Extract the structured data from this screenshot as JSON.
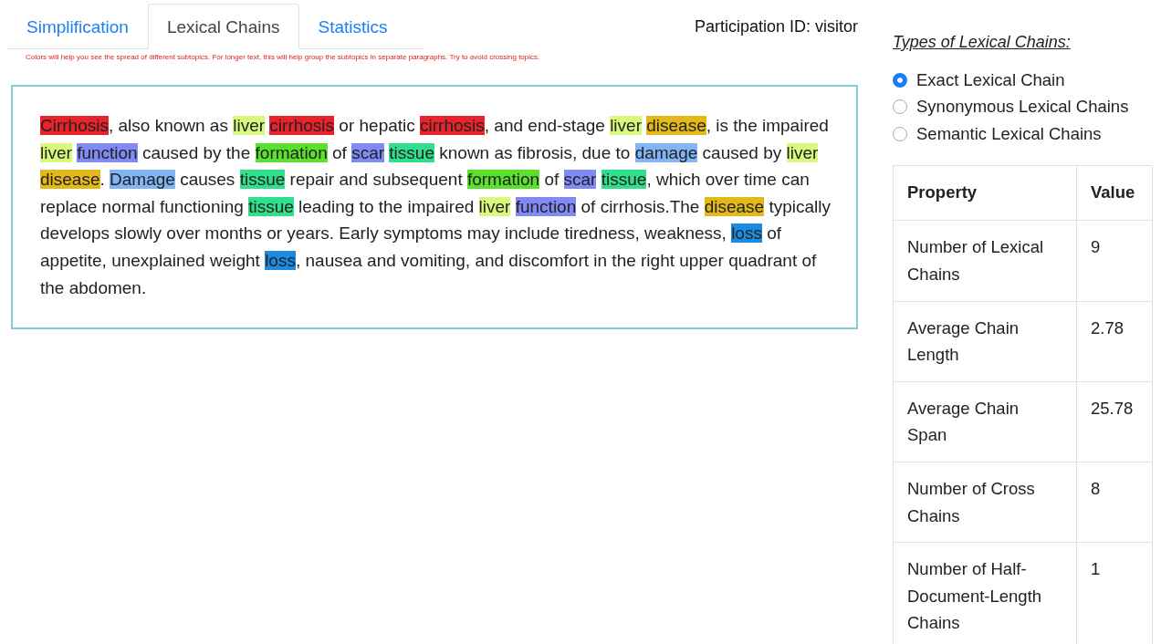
{
  "tabs": [
    {
      "label": "Simplification",
      "selected": false
    },
    {
      "label": "Lexical Chains",
      "selected": true
    },
    {
      "label": "Statistics",
      "selected": false
    }
  ],
  "hint": "Colors will help you see the spread of different subtopics. For longer text, this will help group the subtopics in separate paragraphs. Try to avoid crossing topics.",
  "participation": "Participation ID: visitor",
  "text": [
    {
      "text": "Cirrhosis",
      "color": "#e8232b"
    },
    {
      "text": ", also known as "
    },
    {
      "text": "liver",
      "color": "#d9f97c"
    },
    {
      "text": "cirrhosis",
      "color": "#e8232b"
    },
    {
      "text": " or hepatic "
    },
    {
      "text": "cirrhosis",
      "color": "#e8232b"
    },
    {
      "text": ", and end-stage "
    },
    {
      "text": "liver",
      "color": "#d9f97c"
    },
    {
      "text": "disease",
      "color": "#e3b91a"
    },
    {
      "text": ", is the impaired "
    },
    {
      "text": "liver",
      "color": "#d9f97c"
    },
    {
      "text": "function",
      "color": "#8089f5"
    },
    {
      "text": " caused by the "
    },
    {
      "text": "formation",
      "color": "#5ae12b"
    },
    {
      "text": " of "
    },
    {
      "text": "scar",
      "color": "#8089f5"
    },
    {
      "text": "tissue",
      "color": "#30df8b"
    },
    {
      "text": " known as fibrosis, due to "
    },
    {
      "text": "damage",
      "color": "#82b5f6"
    },
    {
      "text": " caused by "
    },
    {
      "text": "liver",
      "color": "#d9f97c"
    },
    {
      "text": "disease",
      "color": "#e3b91a"
    },
    {
      "text": ". "
    },
    {
      "text": "Damage",
      "color": "#82b5f6"
    },
    {
      "text": " causes "
    },
    {
      "text": "tissue",
      "color": "#30df8b"
    },
    {
      "text": " repair and subsequent "
    },
    {
      "text": "formation",
      "color": "#5ae12b"
    },
    {
      "text": " of "
    },
    {
      "text": "scar",
      "color": "#8089f5"
    },
    {
      "text": "tissue",
      "color": "#30df8b"
    },
    {
      "text": ", which over time can replace normal functioning "
    },
    {
      "text": "tissue",
      "color": "#30df8b"
    },
    {
      "text": " leading to the impaired "
    },
    {
      "text": "liver",
      "color": "#d9f97c"
    },
    {
      "text": "function",
      "color": "#8089f5"
    },
    {
      "text": " of cirrhosis.The "
    },
    {
      "text": "disease",
      "color": "#e3b91a"
    },
    {
      "text": " typically develops slowly over months or years. Early symptoms may include tiredness, weakness, "
    },
    {
      "text": "loss",
      "color": "#1b8be2"
    },
    {
      "text": " of appetite, unexplained weight "
    },
    {
      "text": "loss",
      "color": "#1b8be2"
    },
    {
      "text": ", nausea and vomiting, and discomfort in the right upper quadrant of the abdomen."
    }
  ],
  "types": {
    "title": "Types of Lexical Chains:",
    "options": [
      {
        "label": "Exact Lexical Chain",
        "selected": true
      },
      {
        "label": "Synonymous Lexical Chains",
        "selected": false
      },
      {
        "label": "Semantic Lexical Chains",
        "selected": false
      }
    ]
  },
  "table": {
    "columns": [
      "Property",
      "Value"
    ],
    "rows": [
      [
        "Number of Lexical Chains",
        "9"
      ],
      [
        "Average Chain Length",
        "2.78"
      ],
      [
        "Average Chain Span",
        "25.78"
      ],
      [
        "Number of Cross Chains",
        "8"
      ],
      [
        "Number of Half-Document-Length Chains",
        "1"
      ]
    ]
  }
}
